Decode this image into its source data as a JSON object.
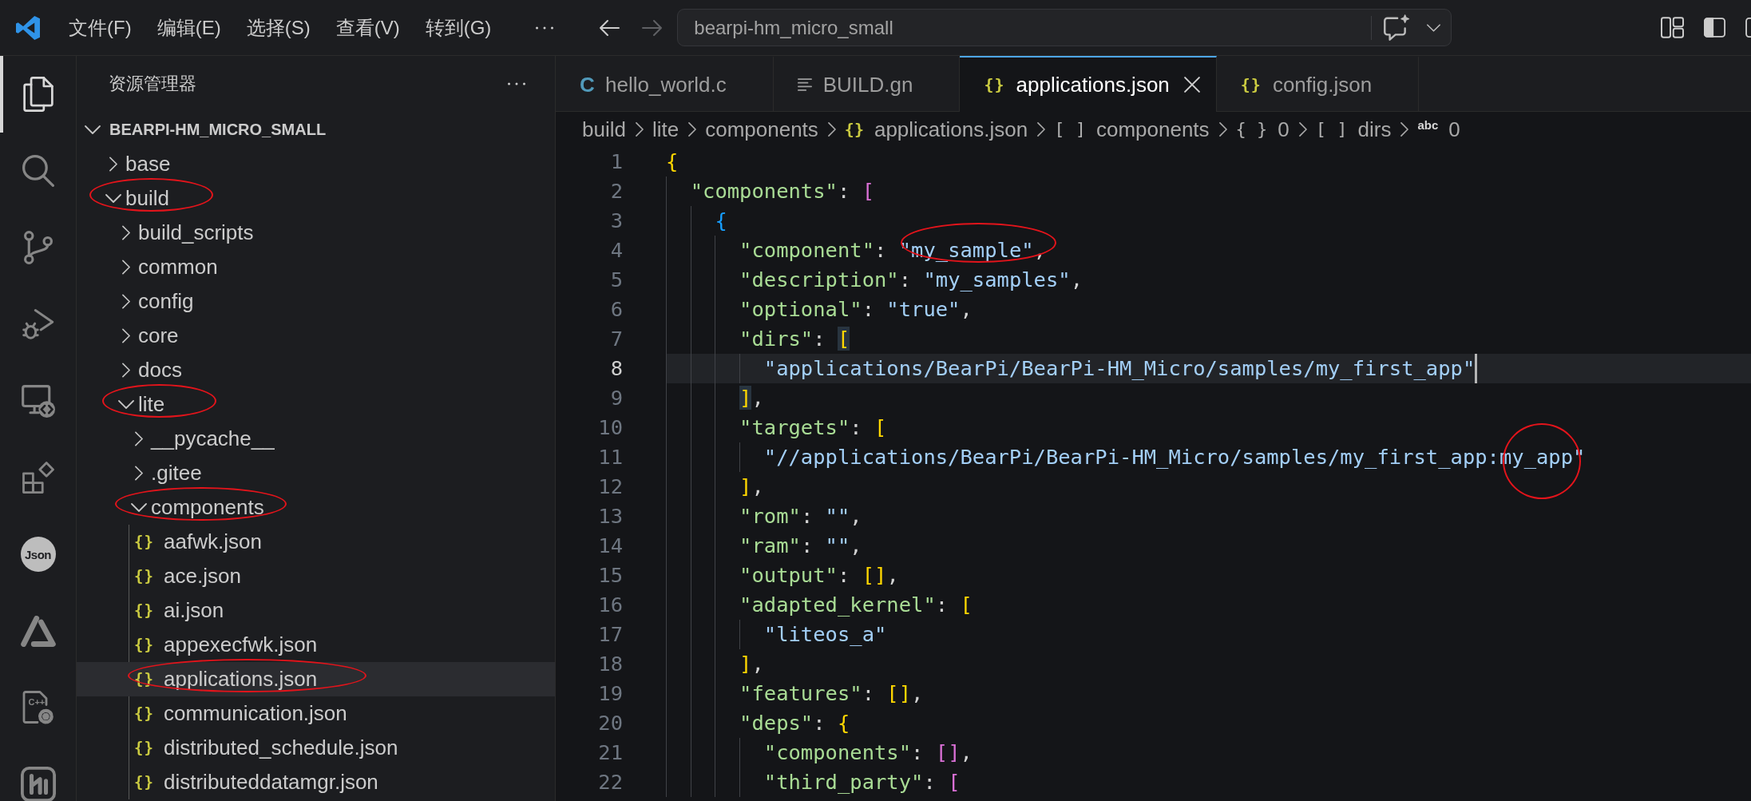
{
  "title_bar": {
    "menu": [
      "文件(F)",
      "编辑(E)",
      "选择(S)",
      "查看(V)",
      "转到(G)"
    ],
    "navigation": [
      {
        "kind": "back",
        "disabled": false
      },
      {
        "kind": "forward",
        "disabled": true
      }
    ],
    "command_center": {
      "label": "bearpi-hm_micro_small"
    }
  },
  "activity_bar": [
    {
      "kind": "explorer",
      "selected": true
    },
    {
      "kind": "search",
      "selected": false
    },
    {
      "kind": "source_control",
      "selected": false
    },
    {
      "kind": "run_debug",
      "selected": false
    },
    {
      "kind": "remote",
      "selected": false
    },
    {
      "kind": "extensions",
      "selected": false
    },
    {
      "kind": "json",
      "text": "Json",
      "selected": false
    },
    {
      "kind": "triangle",
      "selected": false
    },
    {
      "kind": "cpp",
      "text": "C++",
      "selected": false
    },
    {
      "kind": "square_logo",
      "selected": false
    }
  ],
  "sidebar": {
    "title": "资源管理器",
    "root": {
      "label": "BEARPI-HM_MICRO_SMALL",
      "expanded": true
    },
    "items": [
      {
        "label": "base",
        "kind": "folder",
        "expanded": false,
        "selected": false,
        "circled": false
      },
      {
        "label": "build",
        "kind": "folder",
        "expanded": true,
        "selected": false,
        "circled": true,
        "children": [
          {
            "label": "build_scripts",
            "kind": "folder",
            "expanded": false,
            "selected": false,
            "circled": false
          },
          {
            "label": "common",
            "kind": "folder",
            "expanded": false,
            "selected": false,
            "circled": false
          },
          {
            "label": "config",
            "kind": "folder",
            "expanded": false,
            "selected": false,
            "circled": false
          },
          {
            "label": "core",
            "kind": "folder",
            "expanded": false,
            "selected": false,
            "circled": false
          },
          {
            "label": "docs",
            "kind": "folder",
            "expanded": false,
            "selected": false,
            "circled": false
          },
          {
            "label": "lite",
            "kind": "folder",
            "expanded": true,
            "selected": false,
            "circled": true,
            "children": [
              {
                "label": "__pycache__",
                "kind": "folder",
                "expanded": false,
                "selected": false,
                "circled": false
              },
              {
                "label": ".gitee",
                "kind": "folder",
                "expanded": false,
                "selected": false,
                "circled": false
              },
              {
                "label": "components",
                "kind": "folder",
                "expanded": true,
                "selected": false,
                "circled": true,
                "children": [
                  {
                    "label": "aafwk.json",
                    "kind": "file",
                    "icon": "{}",
                    "selected": false,
                    "circled": false
                  },
                  {
                    "label": "ace.json",
                    "kind": "file",
                    "icon": "{}",
                    "selected": false,
                    "circled": false
                  },
                  {
                    "label": "ai.json",
                    "kind": "file",
                    "icon": "{}",
                    "selected": false,
                    "circled": false
                  },
                  {
                    "label": "appexecfwk.json",
                    "kind": "file",
                    "icon": "{}",
                    "selected": false,
                    "circled": false
                  },
                  {
                    "label": "applications.json",
                    "kind": "file",
                    "icon": "{}",
                    "selected": true,
                    "circled": true
                  },
                  {
                    "label": "communication.json",
                    "kind": "file",
                    "icon": "{}",
                    "selected": false,
                    "circled": false
                  },
                  {
                    "label": "distributed_schedule.json",
                    "kind": "file",
                    "icon": "{}",
                    "selected": false,
                    "circled": false
                  },
                  {
                    "label": "distributeddatamgr.json",
                    "kind": "file",
                    "icon": "{}",
                    "selected": false,
                    "circled": false
                  }
                ]
              }
            ]
          }
        ]
      }
    ]
  },
  "tabs": [
    {
      "label": "hello_world.c",
      "kind": "c",
      "icon": "C",
      "selected": false
    },
    {
      "label": "BUILD.gn",
      "kind": "text",
      "selected": false
    },
    {
      "label": "applications.json",
      "kind": "json",
      "icon": "{}",
      "selected": true
    },
    {
      "label": "config.json",
      "kind": "json",
      "icon": "{}",
      "selected": false
    }
  ],
  "breadcrumb": [
    {
      "kind": "folder",
      "label": "build"
    },
    {
      "kind": "folder",
      "label": "lite"
    },
    {
      "kind": "folder",
      "label": "components"
    },
    {
      "kind": "json_file",
      "icon": "{}",
      "label": "applications.json"
    },
    {
      "kind": "array",
      "icon": "[ ]",
      "label": "components"
    },
    {
      "kind": "object",
      "icon": "{ }",
      "label": "0"
    },
    {
      "kind": "array",
      "icon": "[ ]",
      "label": "dirs"
    },
    {
      "kind": "string",
      "icon": "abc",
      "label": "0"
    }
  ],
  "editor": {
    "lines": [
      {
        "number": "1",
        "current": false,
        "tokens": [
          {
            "kind": "open",
            "text": "{",
            "matched": false
          }
        ]
      },
      {
        "number": "2",
        "current": false,
        "tokens": [
          {
            "kind": "key",
            "text": "  \"components\""
          },
          {
            "kind": "punct",
            "text": ": "
          },
          {
            "kind": "open",
            "text": "[",
            "matched": false
          }
        ]
      },
      {
        "number": "3",
        "current": false,
        "tokens": [
          {
            "kind": "open",
            "text": "    {",
            "matched": false
          }
        ]
      },
      {
        "number": "4",
        "current": false,
        "tokens": [
          {
            "kind": "key",
            "text": "      \"component\""
          },
          {
            "kind": "punct",
            "text": ": "
          },
          {
            "kind": "string",
            "text": "\"my_sample\"",
            "circled": true
          },
          {
            "kind": "punct",
            "text": ","
          }
        ]
      },
      {
        "number": "5",
        "current": false,
        "tokens": [
          {
            "kind": "key",
            "text": "      \"description\""
          },
          {
            "kind": "punct",
            "text": ": "
          },
          {
            "kind": "string",
            "text": "\"my_samples\"",
            "circled": false
          },
          {
            "kind": "punct",
            "text": ","
          }
        ]
      },
      {
        "number": "6",
        "current": false,
        "tokens": [
          {
            "kind": "key",
            "text": "      \"optional\""
          },
          {
            "kind": "punct",
            "text": ": "
          },
          {
            "kind": "string",
            "text": "\"true\"",
            "circled": false
          },
          {
            "kind": "punct",
            "text": ","
          }
        ]
      },
      {
        "number": "7",
        "current": false,
        "tokens": [
          {
            "kind": "key",
            "text": "      \"dirs\""
          },
          {
            "kind": "punct",
            "text": ": "
          },
          {
            "kind": "open",
            "text": "[",
            "matched": true
          }
        ]
      },
      {
        "number": "8",
        "current": true,
        "tokens": [
          {
            "kind": "string",
            "text": "        \"applications/BearPi/BearPi-HM_Micro/samples/my_first_app\"",
            "circled": false
          }
        ]
      },
      {
        "number": "9",
        "current": false,
        "tokens": [
          {
            "kind": "close",
            "text": "      ]",
            "matched": true
          },
          {
            "kind": "punct",
            "text": ","
          }
        ]
      },
      {
        "number": "10",
        "current": false,
        "tokens": [
          {
            "kind": "key",
            "text": "      \"targets\""
          },
          {
            "kind": "punct",
            "text": ": "
          },
          {
            "kind": "open",
            "text": "[",
            "matched": false
          }
        ]
      },
      {
        "number": "11",
        "current": false,
        "tokens": [
          {
            "kind": "string",
            "text": "        \"//applications/BearPi/BearPi-HM_Micro/samples/my_first_app:",
            "circled": false
          },
          {
            "kind": "string",
            "text": "my_app",
            "circled": true
          },
          {
            "kind": "string",
            "text": "\"",
            "circled": false
          }
        ]
      },
      {
        "number": "12",
        "current": false,
        "tokens": [
          {
            "kind": "close",
            "text": "      ]",
            "matched": false
          },
          {
            "kind": "punct",
            "text": ","
          }
        ]
      },
      {
        "number": "13",
        "current": false,
        "tokens": [
          {
            "kind": "key",
            "text": "      \"rom\""
          },
          {
            "kind": "punct",
            "text": ": "
          },
          {
            "kind": "string",
            "text": "\"\"",
            "circled": false
          },
          {
            "kind": "punct",
            "text": ","
          }
        ]
      },
      {
        "number": "14",
        "current": false,
        "tokens": [
          {
            "kind": "key",
            "text": "      \"ram\""
          },
          {
            "kind": "punct",
            "text": ": "
          },
          {
            "kind": "string",
            "text": "\"\"",
            "circled": false
          },
          {
            "kind": "punct",
            "text": ","
          }
        ]
      },
      {
        "number": "15",
        "current": false,
        "tokens": [
          {
            "kind": "key",
            "text": "      \"output\""
          },
          {
            "kind": "punct",
            "text": ": "
          },
          {
            "kind": "open",
            "text": "[",
            "matched": false
          },
          {
            "kind": "close",
            "text": "]",
            "matched": false
          },
          {
            "kind": "punct",
            "text": ","
          }
        ]
      },
      {
        "number": "16",
        "current": false,
        "tokens": [
          {
            "kind": "key",
            "text": "      \"adapted_kernel\""
          },
          {
            "kind": "punct",
            "text": ": "
          },
          {
            "kind": "open",
            "text": "[",
            "matched": false
          }
        ]
      },
      {
        "number": "17",
        "current": false,
        "tokens": [
          {
            "kind": "string",
            "text": "        \"liteos_a\"",
            "circled": false
          }
        ]
      },
      {
        "number": "18",
        "current": false,
        "tokens": [
          {
            "kind": "close",
            "text": "      ]",
            "matched": false
          },
          {
            "kind": "punct",
            "text": ","
          }
        ]
      },
      {
        "number": "19",
        "current": false,
        "tokens": [
          {
            "kind": "key",
            "text": "      \"features\""
          },
          {
            "kind": "punct",
            "text": ": "
          },
          {
            "kind": "open",
            "text": "[",
            "matched": false
          },
          {
            "kind": "close",
            "text": "]",
            "matched": false
          },
          {
            "kind": "punct",
            "text": ","
          }
        ]
      },
      {
        "number": "20",
        "current": false,
        "tokens": [
          {
            "kind": "key",
            "text": "      \"deps\""
          },
          {
            "kind": "punct",
            "text": ": "
          },
          {
            "kind": "open",
            "text": "{",
            "matched": false
          }
        ]
      },
      {
        "number": "21",
        "current": false,
        "tokens": [
          {
            "kind": "key",
            "text": "        \"components\""
          },
          {
            "kind": "punct",
            "text": ": "
          },
          {
            "kind": "open",
            "text": "[",
            "matched": false
          },
          {
            "kind": "close",
            "text": "]",
            "matched": false
          },
          {
            "kind": "punct",
            "text": ","
          }
        ]
      },
      {
        "number": "22",
        "current": false,
        "tokens": [
          {
            "kind": "key",
            "text": "        \"third_party\""
          },
          {
            "kind": "punct",
            "text": ": "
          },
          {
            "kind": "open",
            "text": "[",
            "matched": false
          }
        ]
      }
    ]
  }
}
